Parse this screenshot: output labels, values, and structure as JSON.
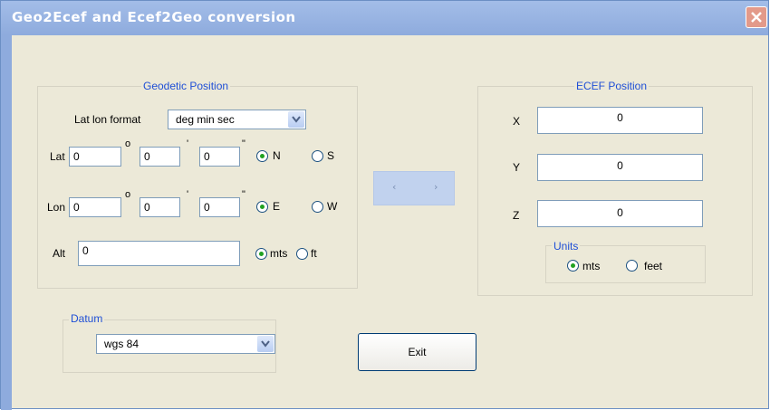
{
  "window": {
    "title": "Geo2Ecef and Ecef2Geo conversion"
  },
  "geodetic": {
    "title": "Geodetic Position",
    "format_label": "Lat lon format",
    "format_value": "deg min sec",
    "lat": {
      "label": "Lat",
      "deg": "0",
      "min": "0",
      "sec": "0",
      "hem1": "N",
      "hem2": "S",
      "selected": "N"
    },
    "lon": {
      "label": "Lon",
      "deg": "0",
      "min": "0",
      "sec": "0",
      "hem1": "E",
      "hem2": "W",
      "selected": "E"
    },
    "alt": {
      "label": "Alt",
      "value": "0",
      "unit1": "mts",
      "unit2": "ft",
      "selected": "mts"
    },
    "deg_symbol": "o",
    "min_symbol": "'",
    "sec_symbol": "\""
  },
  "ecef": {
    "title": "ECEF Position",
    "x_label": "X",
    "x_value": "0",
    "y_label": "Y",
    "y_value": "0",
    "z_label": "Z",
    "z_value": "0",
    "units_title": "Units",
    "unit1": "mts",
    "unit2": "feet",
    "selected": "mts"
  },
  "datum": {
    "title": "Datum",
    "value": "wgs 84"
  },
  "convert": {
    "left": "‹",
    "right": "›"
  },
  "exit_label": "Exit"
}
